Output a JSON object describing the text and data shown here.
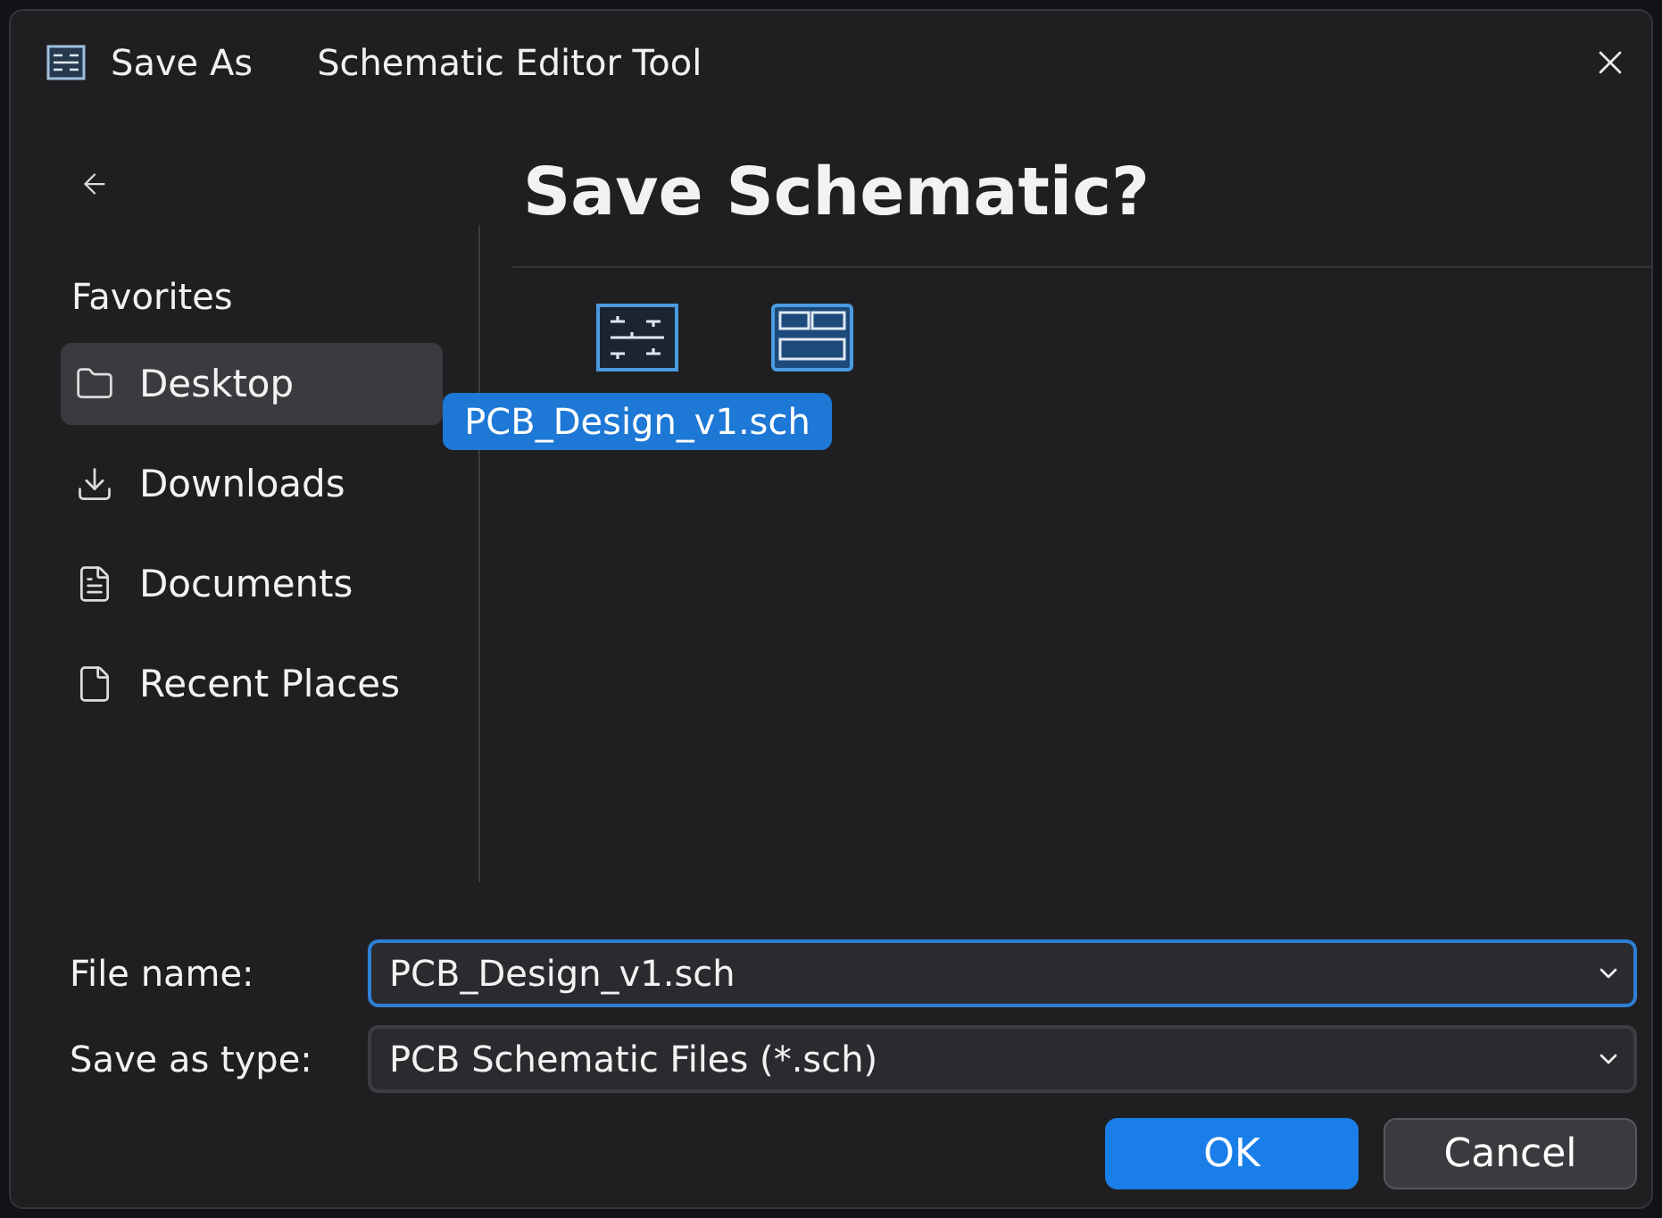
{
  "window": {
    "title": "Save As",
    "app": "Schematic Editor Tool"
  },
  "sidebar": {
    "heading": "Favorites",
    "items": [
      {
        "label": "Desktop",
        "kind": "folder",
        "selected": true
      },
      {
        "label": "Downloads",
        "kind": "download",
        "selected": false
      },
      {
        "label": "Documents",
        "kind": "document",
        "selected": false
      },
      {
        "label": "Recent Places",
        "kind": "page",
        "selected": false
      }
    ]
  },
  "main": {
    "heading": "Save Schematic?",
    "files": [
      {
        "kind": "schematic",
        "label": "PCB_Design_v1.sch",
        "selected": true
      },
      {
        "kind": "layout"
      }
    ]
  },
  "file_name": {
    "label": "File name:",
    "value": "PCB_Design_v1.sch"
  },
  "save_type": {
    "label": "Save as type:",
    "value": "PCB Schematic Files (*.sch)"
  },
  "buttons": [
    {
      "label": "OK",
      "kind": "primary"
    },
    {
      "label": "Cancel",
      "kind": "secondary"
    }
  ]
}
